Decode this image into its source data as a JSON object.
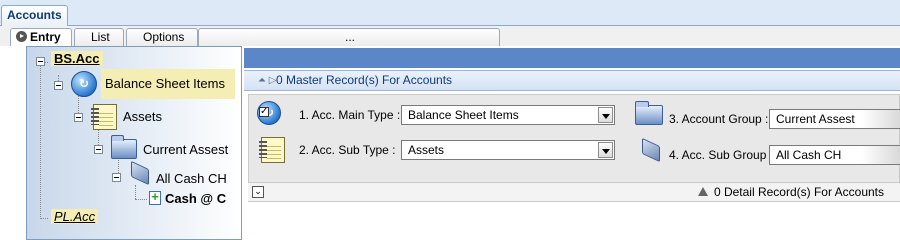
{
  "window": {
    "tab_label": "Accounts"
  },
  "subtabs": [
    {
      "label": "Entry"
    },
    {
      "label": "List"
    },
    {
      "label": "Options"
    },
    {
      "label": "..."
    }
  ],
  "tree": {
    "root_bs": "BS.Acc",
    "balance_sheet_items": "Balance Sheet Items",
    "assets": "Assets",
    "current_assest": "Current Assest",
    "all_cash": "All Cash CH",
    "cash_c": "Cash @ C",
    "root_pl": "PL.Acc"
  },
  "master_bar": {
    "text": "0 Master Record(s) For Accounts"
  },
  "form": {
    "main_type_label": "1. Acc. Main Type :",
    "main_type_value": "Balance Sheet Items",
    "sub_type_label": "2. Acc. Sub Type :",
    "sub_type_value": "Assets",
    "group_label": "3. Account Group :",
    "group_value": "Current Assest",
    "sub_group_label": "4. Acc. Sub Group :",
    "sub_group_value": "All Cash CH"
  },
  "detail_bar": {
    "text": "0 Detail Record(s) For Accounts"
  },
  "colors": {
    "tab_text": "#103a74",
    "blue_band": "#5b86c7",
    "highlight": "#f4eeb4"
  }
}
